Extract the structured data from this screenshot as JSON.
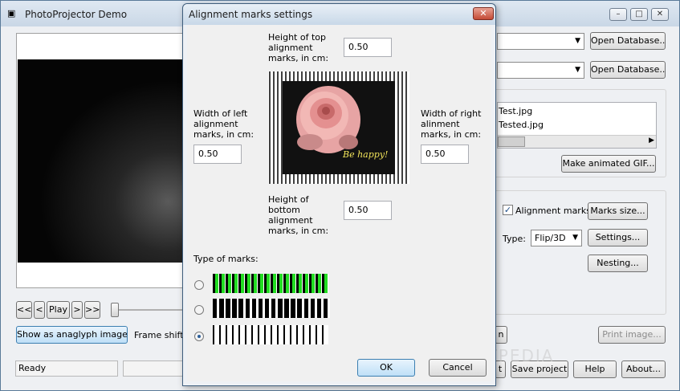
{
  "main": {
    "title": "PhotoProjector Demo",
    "buttons": {
      "open_db_1": "Open Database...",
      "open_db_2": "Open Database...",
      "make_gif": "Make animated GIF...",
      "marks_size": "Marks size...",
      "settings": "Settings...",
      "nesting": "Nesting...",
      "print_image": "Print image...",
      "save_project": "Save project",
      "help": "Help",
      "about": "About...",
      "first": "<<",
      "prev": "<",
      "play": "Play",
      "next": ">",
      "last": ">>",
      "anaglyph": "Show as anaglyph image",
      "partial_n": "n",
      "partial_t": "t"
    },
    "files": [
      "Test.jpg",
      "Tested.jpg"
    ],
    "alignment_marks_label": "Alignment marks",
    "alignment_marks_checked": true,
    "type_label": "Type:",
    "type_value": "Flip/3D",
    "frame_shift_label": "Frame shift f",
    "status": "Ready",
    "watermark": "SOFTPEDIA"
  },
  "dialog": {
    "title": "Alignment marks settings",
    "close_icon": "close-icon",
    "top_label": "Height of top alignment marks, in cm:",
    "top_value": "0.50",
    "left_label": "Width of left alignment marks, in cm:",
    "left_value": "0.50",
    "right_label": "Width of right alinment marks, in cm:",
    "right_value": "0.50",
    "bottom_label": "Height of bottom alignment marks, in cm:",
    "bottom_value": "0.50",
    "preview_caption": "Be happy!",
    "type_of_marks_label": "Type of marks:",
    "selected_mark_type": 3,
    "ok": "OK",
    "cancel": "Cancel",
    "colors": {
      "green_mark": "#22dd22",
      "black_mark": "#000000"
    }
  }
}
